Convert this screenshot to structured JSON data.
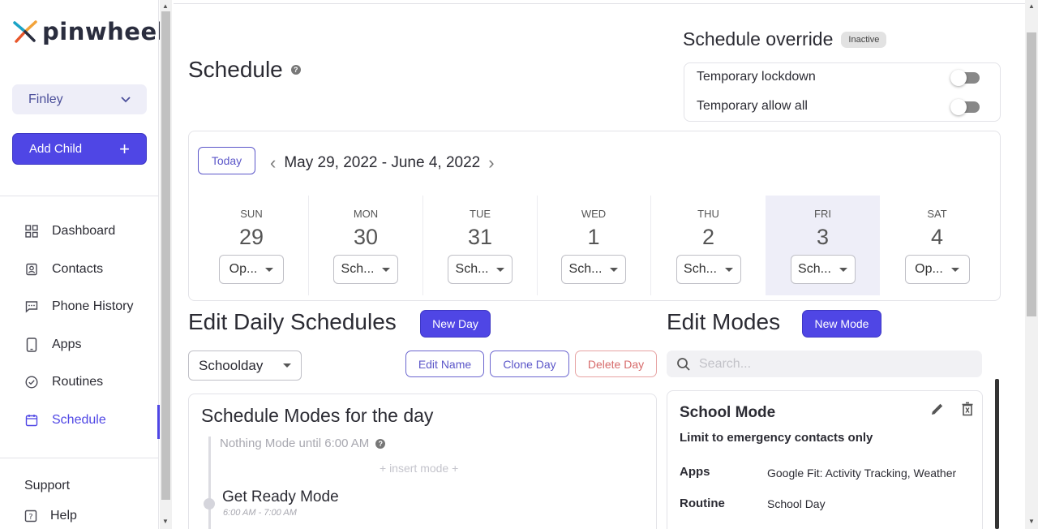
{
  "brand": {
    "name": "pinwheel"
  },
  "sidebar": {
    "child_selected": "Finley",
    "add_child_label": "Add Child",
    "nav": [
      {
        "label": "Dashboard",
        "icon": "dashboard-icon"
      },
      {
        "label": "Contacts",
        "icon": "contacts-icon"
      },
      {
        "label": "Phone History",
        "icon": "chat-icon"
      },
      {
        "label": "Apps",
        "icon": "phone-icon"
      },
      {
        "label": "Routines",
        "icon": "check-circle-icon"
      },
      {
        "label": "Schedule",
        "icon": "calendar-icon",
        "active": true
      }
    ],
    "support_label": "Support",
    "help_label": "Help"
  },
  "page": {
    "title": "Schedule",
    "help_mark": "?"
  },
  "override": {
    "title": "Schedule override",
    "status_badge": "Inactive",
    "toggles": [
      {
        "label": "Temporary lockdown",
        "on": false
      },
      {
        "label": "Temporary allow all",
        "on": false
      }
    ]
  },
  "week": {
    "today_label": "Today",
    "range": "May 29, 2022 - June 4, 2022",
    "days": [
      {
        "dow": "SUN",
        "num": "29",
        "mode": "Op..."
      },
      {
        "dow": "MON",
        "num": "30",
        "mode": "Sch..."
      },
      {
        "dow": "TUE",
        "num": "31",
        "mode": "Sch..."
      },
      {
        "dow": "WED",
        "num": "1",
        "mode": "Sch..."
      },
      {
        "dow": "THU",
        "num": "2",
        "mode": "Sch..."
      },
      {
        "dow": "FRI",
        "num": "3",
        "mode": "Sch...",
        "selected": true
      },
      {
        "dow": "SAT",
        "num": "4",
        "mode": "Op..."
      }
    ]
  },
  "daily": {
    "title": "Edit Daily Schedules",
    "new_day_label": "New Day",
    "selected_schedule": "Schoolday",
    "edit_name_label": "Edit Name",
    "clone_day_label": "Clone Day",
    "delete_day_label": "Delete Day",
    "modes_title": "Schedule Modes for the day",
    "nothing_mode": "Nothing Mode until 6:00 AM",
    "insert_label": "+ insert mode +",
    "first_mode_name": "Get Ready Mode",
    "first_mode_time": "6:00 AM - 7:00 AM"
  },
  "modes": {
    "title": "Edit Modes",
    "new_mode_label": "New Mode",
    "search_placeholder": "Search...",
    "card": {
      "name": "School Mode",
      "description": "Limit to emergency contacts only",
      "apps_label": "Apps",
      "apps_value": "Google Fit: Activity Tracking, Weather",
      "routine_label": "Routine",
      "routine_value": "School Day"
    }
  },
  "colors": {
    "accent": "#4f46e5",
    "danger": "#d76b6b"
  }
}
